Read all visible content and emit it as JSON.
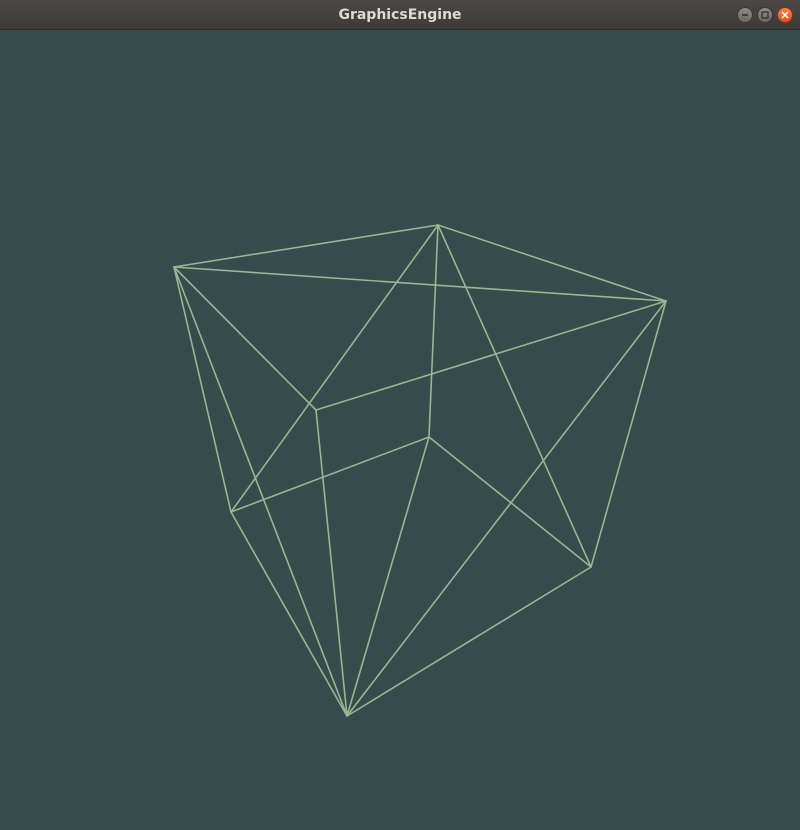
{
  "window": {
    "title": "GraphicsEngine"
  },
  "controls": {
    "minimize_icon": "minimize-icon",
    "maximize_icon": "maximize-icon",
    "close_icon": "close-icon"
  },
  "colors": {
    "background": "#334c4c",
    "wireframe": "#96b694",
    "titlebar": "#3c3b37",
    "title_text": "#dfdbd2",
    "close": "#e95420"
  }
}
